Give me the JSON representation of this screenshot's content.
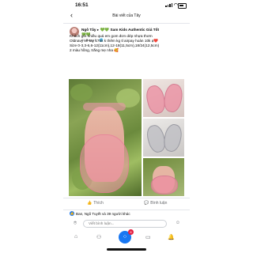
{
  "status": {
    "time": "16:51"
  },
  "nav": {
    "title": "Bài viết của Tây"
  },
  "post": {
    "author": "Ngô Tây",
    "arrow": "▸",
    "hearts_before": "💚💚",
    "group": "Sam Kids Authentic Giá Tốt",
    "hearts_after": "💚💚",
    "time": "21 tháng 5 · 🌐",
    "lines": [
      "Khách gửi nhiều quá em gom đơn dép nhựa thơm",
      "Oldnavy về tay 175k k thêm kg tl airpay hoàn 10k ạ❤️",
      "Size 0-3,3-6,6-12(11cm),12-18(11,5cm),18/24(12,5cm)",
      "2 màu hồng, trắng mẹ nha 🥰"
    ]
  },
  "actions": {
    "like": "Thích",
    "comment": "Bình luận"
  },
  "reactions": {
    "text": "Ban, Ngô Tuyết và 39 người khác"
  },
  "comment_bar": {
    "placeholder": "Viết bình luận..."
  },
  "tab_badge": "8",
  "icons": [
    "back-icon",
    "signal-icon",
    "wifi-icon",
    "battery-icon",
    "avatar",
    "like-icon",
    "comment-icon",
    "camera-icon",
    "emoji-icon",
    "home-icon",
    "people-icon",
    "menu-icon",
    "bell-icon"
  ]
}
